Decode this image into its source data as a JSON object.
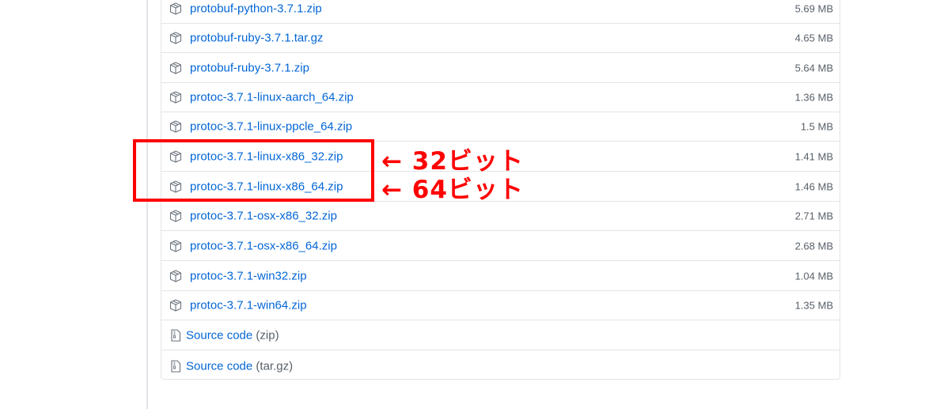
{
  "assets": [
    {
      "name": "protobuf-python-3.7.1.zip",
      "size": "5.69 MB"
    },
    {
      "name": "protobuf-ruby-3.7.1.tar.gz",
      "size": "4.65 MB"
    },
    {
      "name": "protobuf-ruby-3.7.1.zip",
      "size": "5.64 MB"
    },
    {
      "name": "protoc-3.7.1-linux-aarch_64.zip",
      "size": "1.36 MB"
    },
    {
      "name": "protoc-3.7.1-linux-ppcle_64.zip",
      "size": "1.5 MB"
    },
    {
      "name": "protoc-3.7.1-linux-x86_32.zip",
      "size": "1.41 MB"
    },
    {
      "name": "protoc-3.7.1-linux-x86_64.zip",
      "size": "1.46 MB"
    },
    {
      "name": "protoc-3.7.1-osx-x86_32.zip",
      "size": "2.71 MB"
    },
    {
      "name": "protoc-3.7.1-osx-x86_64.zip",
      "size": "2.68 MB"
    },
    {
      "name": "protoc-3.7.1-win32.zip",
      "size": "1.04 MB"
    },
    {
      "name": "protoc-3.7.1-win64.zip",
      "size": "1.35 MB"
    }
  ],
  "source_code": [
    {
      "label": "Source code",
      "ext": "(zip)"
    },
    {
      "label": "Source code",
      "ext": "(tar.gz)"
    }
  ],
  "annotations": {
    "bit32": "← 32ビット",
    "bit64": "← 64ビット"
  },
  "colors": {
    "link": "#0366d6",
    "muted": "#586069",
    "border": "#e1e4e8",
    "highlight": "#ff0000"
  },
  "icons": {
    "asset": "package-icon",
    "source": "file-zip-icon"
  }
}
